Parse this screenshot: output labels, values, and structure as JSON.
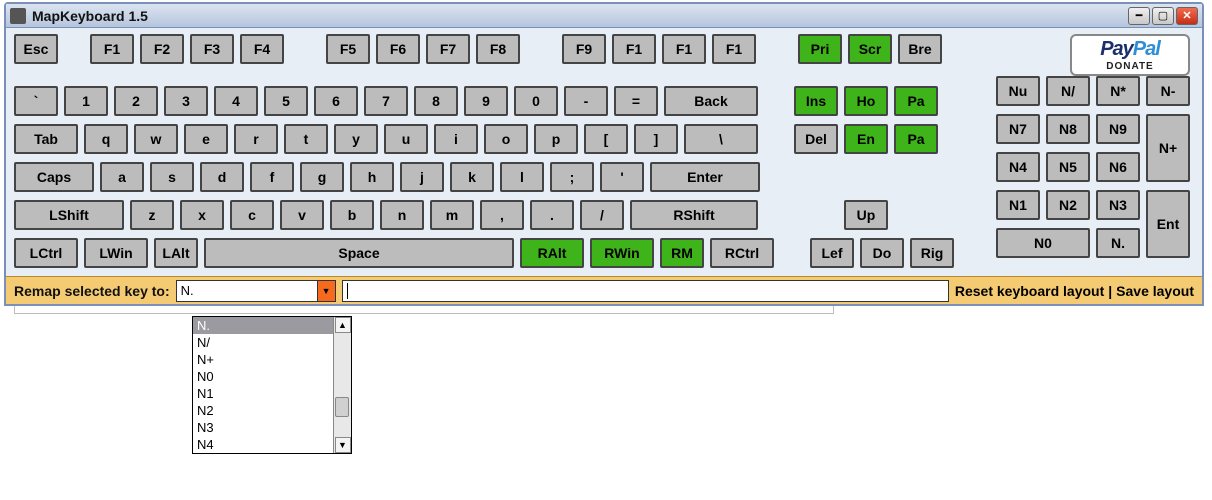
{
  "window": {
    "title": "MapKeyboard 1.5"
  },
  "paypal": {
    "brand1": "Pay",
    "brand2": "Pal",
    "donate": "DONATE"
  },
  "rows": {
    "fn": [
      "Esc",
      "F1",
      "F2",
      "F3",
      "F4",
      "F5",
      "F6",
      "F7",
      "F8",
      "F9",
      "F1",
      "F1",
      "F1",
      "Pri",
      "Scr",
      "Bre"
    ],
    "num": [
      "`",
      "1",
      "2",
      "3",
      "4",
      "5",
      "6",
      "7",
      "8",
      "9",
      "0",
      "-",
      "=",
      "Back",
      "Ins",
      "Ho",
      "Pa"
    ],
    "qw": [
      "Tab",
      "q",
      "w",
      "e",
      "r",
      "t",
      "y",
      "u",
      "i",
      "o",
      "p",
      "[",
      "]",
      "\\",
      "Del",
      "En",
      "Pa"
    ],
    "as": [
      "Caps",
      "a",
      "s",
      "d",
      "f",
      "g",
      "h",
      "j",
      "k",
      "l",
      ";",
      "'",
      "Enter"
    ],
    "zx": [
      "LShift",
      "z",
      "x",
      "c",
      "v",
      "b",
      "n",
      "m",
      ",",
      ".",
      "/",
      "RShift",
      "Up"
    ],
    "sp": [
      "LCtrl",
      "LWin",
      "LAlt",
      "Space",
      "RAlt",
      "RWin",
      "RM",
      "RCtrl",
      "Lef",
      "Do",
      "Rig"
    ]
  },
  "numpad": [
    "Nu",
    "N/",
    "N*",
    "N-",
    "N7",
    "N8",
    "N9",
    "N+",
    "N4",
    "N5",
    "N6",
    "N1",
    "N2",
    "N3",
    "Ent",
    "N0",
    "N."
  ],
  "status": {
    "remap_label": "Remap selected key to:",
    "combo_value": "N.",
    "reset": "Reset keyboard layout",
    "sep": "|",
    "save": "Save layout"
  },
  "dropdown": [
    "N.",
    "N/",
    "N+",
    "N0",
    "N1",
    "N2",
    "N3",
    "N4"
  ]
}
